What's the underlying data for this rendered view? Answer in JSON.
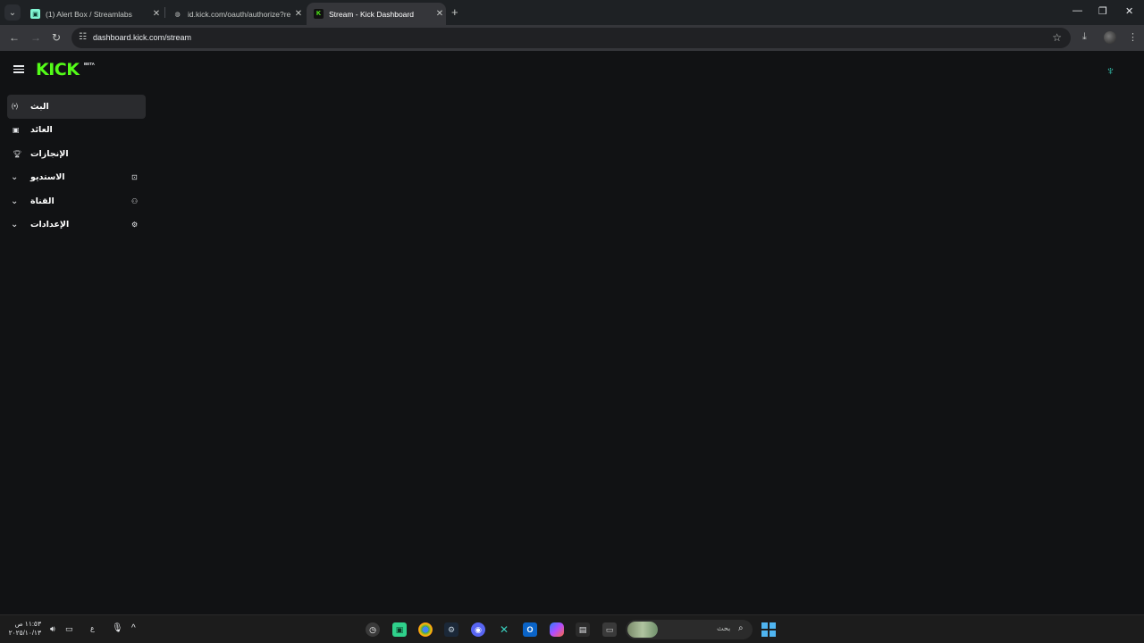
{
  "browser": {
    "tabs": [
      {
        "title": "(1) Alert Box / Streamlabs",
        "favicon": "streamlabs-icon",
        "active": false
      },
      {
        "title": "id.kick.com/oauth/authorize?re",
        "favicon": "globe-icon",
        "active": false
      },
      {
        "title": "Stream - Kick Dashboard",
        "favicon": "kick-icon",
        "active": true
      }
    ],
    "url": "dashboard.kick.com/stream"
  },
  "page": {
    "logo": "KICK",
    "logo_badge": "BETA",
    "sidebar": {
      "items": [
        {
          "label": "البث",
          "icon": "live-icon",
          "active": true,
          "expandable": false
        },
        {
          "label": "العائد",
          "icon": "revenue-icon",
          "active": false,
          "expandable": false
        },
        {
          "label": "الإنجازات",
          "icon": "trophy-icon",
          "active": false,
          "expandable": false
        },
        {
          "label": "الاستديو",
          "icon": "studio-icon",
          "active": false,
          "expandable": true
        },
        {
          "label": "القناة",
          "icon": "channel-icon",
          "active": false,
          "expandable": true
        },
        {
          "label": "الإعدادات",
          "icon": "gear-icon",
          "active": false,
          "expandable": true
        }
      ]
    }
  },
  "taskbar": {
    "search_placeholder": "بحث",
    "clock_time": "١١:٥٣ ص",
    "clock_date": "٢٠٢٥/١٠/١٣",
    "input_language": "ع"
  },
  "colors": {
    "kick_green": "#53fc18",
    "page_background": "#111214"
  }
}
